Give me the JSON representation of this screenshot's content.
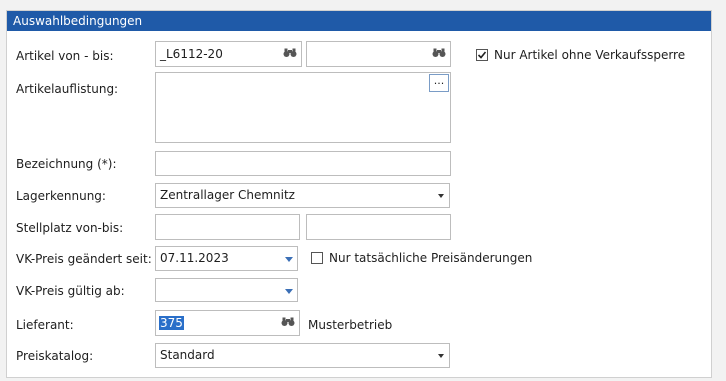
{
  "header": {
    "title": "Auswahlbedingungen"
  },
  "labels": {
    "artikel_von_bis": "Artikel von - bis:",
    "artikelauflistung": "Artikelauflistung:",
    "bezeichnung": "Bezeichnung (*):",
    "lagerkennung": "Lagerkennung:",
    "stellplatz": "Stellplatz von-bis:",
    "vk_geaendert": "VK-Preis geändert seit:",
    "vk_gueltig": "VK-Preis gültig ab:",
    "lieferant": "Lieferant:",
    "preiskatalog": "Preiskatalog:"
  },
  "fields": {
    "artikel_von": "_L6112-20",
    "artikel_bis": "",
    "artikelauflistung": "",
    "artikelauflistung_button": "...",
    "bezeichnung": "",
    "lagerkennung": "Zentrallager Chemnitz",
    "stellplatz_von": "",
    "stellplatz_bis": "",
    "vk_geaendert": "07.11.2023",
    "vk_gueltig": "",
    "lieferant": "375",
    "lieferant_name": "Musterbetrieb",
    "preiskatalog": "Standard"
  },
  "checkboxes": {
    "nur_artikel": {
      "label": "Nur Artikel ohne Verkaufssperre",
      "checked": true
    },
    "nur_preisaenderungen": {
      "label": "Nur tatsächliche Preisänderungen",
      "checked": false
    }
  },
  "icons": {
    "lookup": "binoculars-icon",
    "dropdown": "chevron-down-icon"
  },
  "colors": {
    "header": "#1f5aa8",
    "selection": "#2a6fc9",
    "spin_arrow": "#3b6fb6"
  }
}
